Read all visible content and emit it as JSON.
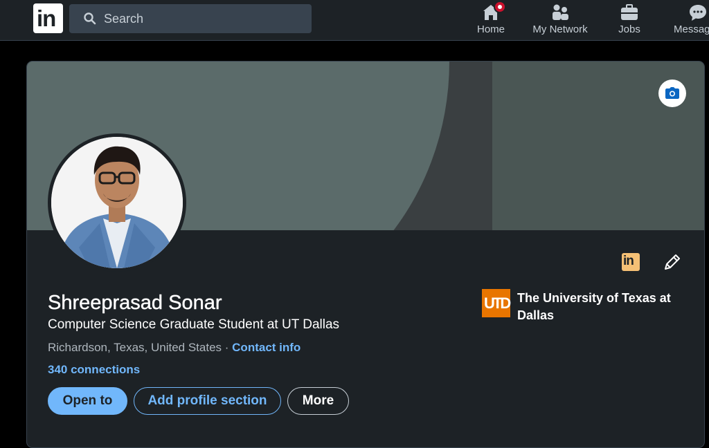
{
  "nav": {
    "logo_text": "in",
    "search_placeholder": "Search",
    "items": [
      {
        "label": "Home",
        "icon": "home-icon",
        "has_notification": true
      },
      {
        "label": "My Network",
        "icon": "network-icon"
      },
      {
        "label": "Jobs",
        "icon": "briefcase-icon"
      },
      {
        "label": "Messag",
        "icon": "messaging-icon"
      }
    ]
  },
  "profile": {
    "name": "Shreeprasad Sonar",
    "headline": "Computer Science Graduate Student at UT Dallas",
    "location": "Richardson, Texas, United States",
    "separator": " · ",
    "contact_link": "Contact info",
    "connections": "340 connections",
    "actions": {
      "open_to": "Open to",
      "add_section": "Add profile section",
      "more": "More"
    },
    "education": {
      "logo_text": "UTD",
      "name": "The University of Texas at Dallas"
    },
    "premium_badge_text": "in"
  },
  "colors": {
    "nav_bg": "#1d2226",
    "card_bg": "#1d2226",
    "accent_blue": "#71b7fb",
    "notification_red": "#cb112d",
    "utd_orange": "#e87500",
    "premium_gold": "#f5c075"
  }
}
